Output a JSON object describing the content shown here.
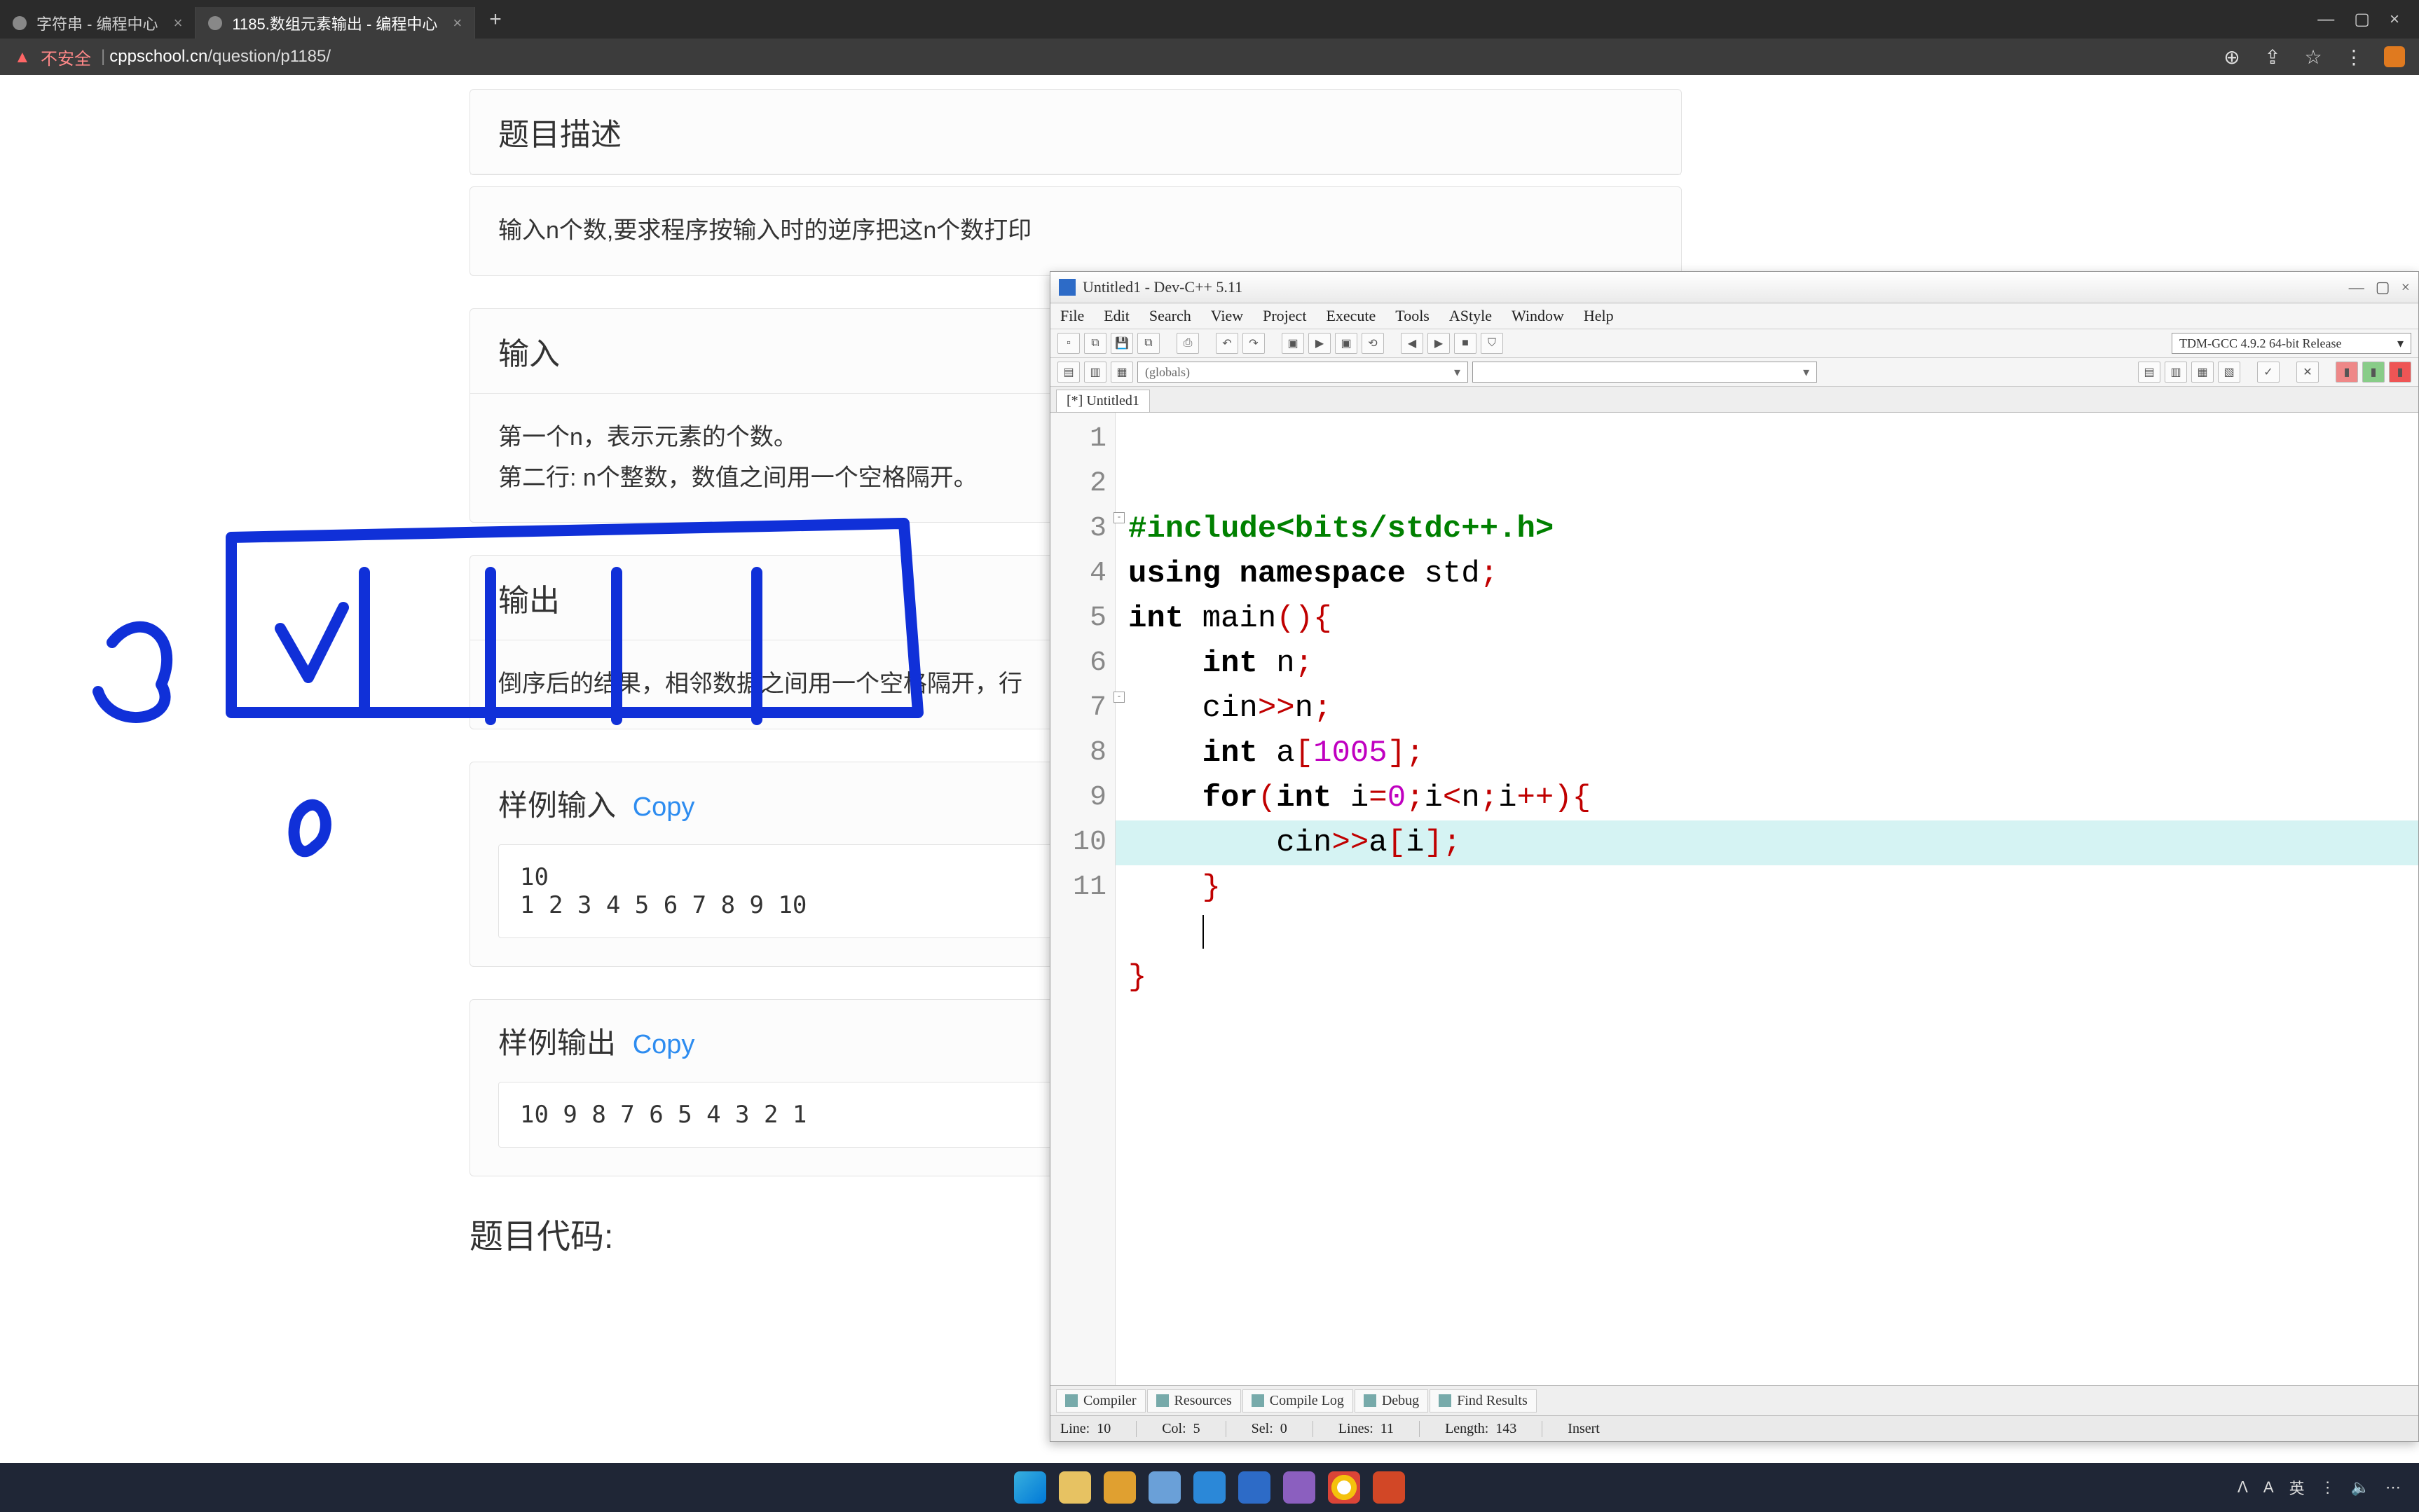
{
  "browser": {
    "tabs": [
      {
        "title": "字符串 - 编程中心",
        "active": false
      },
      {
        "title": "1185.数组元素输出 - 编程中心",
        "active": true
      }
    ],
    "insecure_label": "不安全",
    "url_domain": "cppschool.cn",
    "url_path": "/question/p1185/"
  },
  "problem": {
    "desc_title": "题目描述",
    "desc_body": "输入n个数,要求程序按输入时的逆序把这n个数打印",
    "input_title": "输入",
    "input_body_l1": "第一个n，表示元素的个数。",
    "input_body_l2": "第二行: n个整数，数值之间用一个空格隔开。",
    "output_title": "输出",
    "output_body": "倒序后的结果，相邻数据之间用一个空格隔开，行",
    "sample_in_title": "样例输入",
    "sample_out_title": "样例输出",
    "copy_label": "Copy",
    "sample_in": "10\n1 2 3 4 5 6 7 8 9 10",
    "sample_out": "10 9 8 7 6 5 4 3 2 1",
    "code_title": "题目代码:"
  },
  "devcpp": {
    "title": "Untitled1 - Dev-C++ 5.11",
    "menus": [
      "File",
      "Edit",
      "Search",
      "View",
      "Project",
      "Execute",
      "Tools",
      "AStyle",
      "Window",
      "Help"
    ],
    "compiler": "TDM-GCC 4.9.2 64-bit Release",
    "globals": "(globals)",
    "file_tab": "[*] Untitled1",
    "lines": [
      "1",
      "2",
      "3",
      "4",
      "5",
      "6",
      "7",
      "8",
      "9",
      "10",
      "11"
    ],
    "bottom_tabs": [
      "Compiler",
      "Resources",
      "Compile Log",
      "Debug",
      "Find Results"
    ],
    "status": {
      "line_label": "Line:",
      "line": "10",
      "col_label": "Col:",
      "col": "5",
      "sel_label": "Sel:",
      "sel": "0",
      "lines_label": "Lines:",
      "lines": "11",
      "len_label": "Length:",
      "len": "143",
      "mode": "Insert"
    },
    "code": {
      "l1a": "#include",
      "l1b": "<bits/stdc++.h>",
      "l2a": "using",
      "l2b": "namespace",
      "l2c": "std",
      "l3a": "int",
      "l3b": "main",
      "l4a": "int",
      "l4b": "n",
      "l5a": "cin",
      "l5b": "n",
      "l6a": "int",
      "l6b": "a",
      "l6c": "1005",
      "l7a": "for",
      "l7b": "int",
      "l7c": "i",
      "l7d": "0",
      "l7e": "i",
      "l7f": "n",
      "l7g": "i",
      "l8a": "cin",
      "l8b": "a",
      "l8c": "i"
    }
  },
  "tray": {
    "up": "ᐱ",
    "lang1": "A",
    "lang2": "英",
    "wifi": "⋮",
    "vol": "🔈",
    "more": "⋯"
  }
}
